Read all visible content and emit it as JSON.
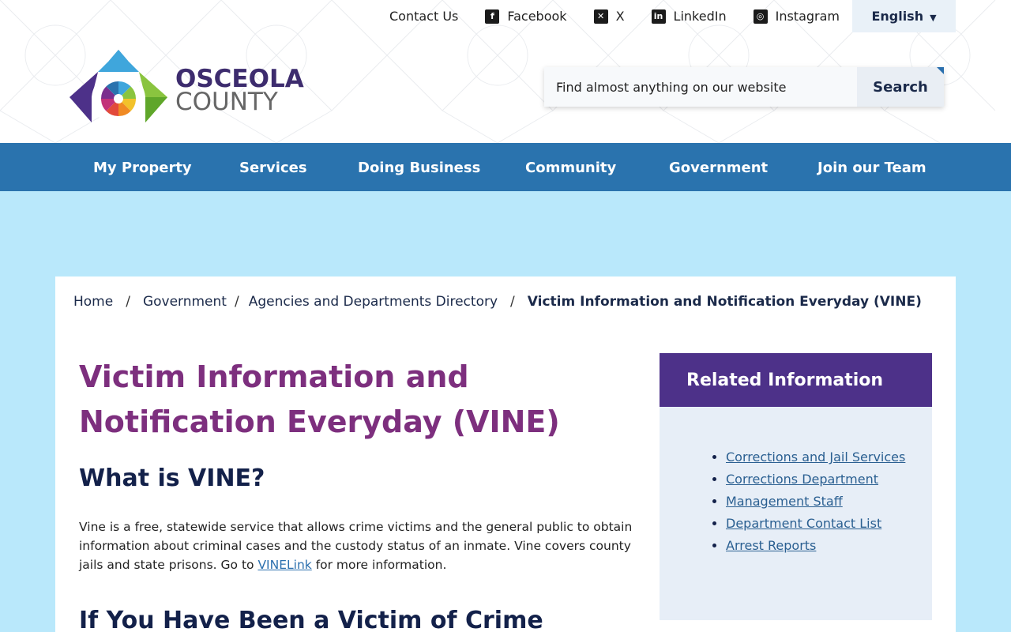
{
  "utility": {
    "contact": "Contact Us",
    "facebook": "Facebook",
    "x": "X",
    "linkedin": "LinkedIn",
    "instagram": "Instagram",
    "language": "English"
  },
  "logo": {
    "line1": "OSCEOLA",
    "line2": "COUNTY"
  },
  "search": {
    "placeholder": "Find almost anything on our website",
    "button": "Search"
  },
  "nav": {
    "items": [
      "My Property",
      "Services",
      "Doing Business",
      "Community",
      "Government",
      "Join our Team"
    ]
  },
  "breadcrumb": {
    "home": "Home",
    "government": "Government",
    "agencies": "Agencies and Departments Directory",
    "current": "Victim Information and Notification Everyday (VINE)",
    "separator": "/"
  },
  "page": {
    "title": "Victim Information and Notification Everyday (VINE)",
    "h2_what": "What is VINE?",
    "body_before_link": "Vine is a free, statewide service that allows crime victims and the general public to obtain information about criminal cases and the custody status of an inmate. Vine covers county jails and state prisons. Go to ",
    "link": "VINELink",
    "body_after_link": " for more information.",
    "h2_victim": "If You Have Been a Victim of Crime"
  },
  "related": {
    "heading": "Related Information",
    "links": [
      "Corrections and Jail Services",
      "Corrections Department",
      "Management Staff",
      "Department Contact List",
      "Arrest Reports"
    ]
  },
  "colors": {
    "nav": "#2a73ae",
    "title": "#7d2f7e",
    "related_head": "#4d3189",
    "page_bg": "#b9e8fb"
  }
}
